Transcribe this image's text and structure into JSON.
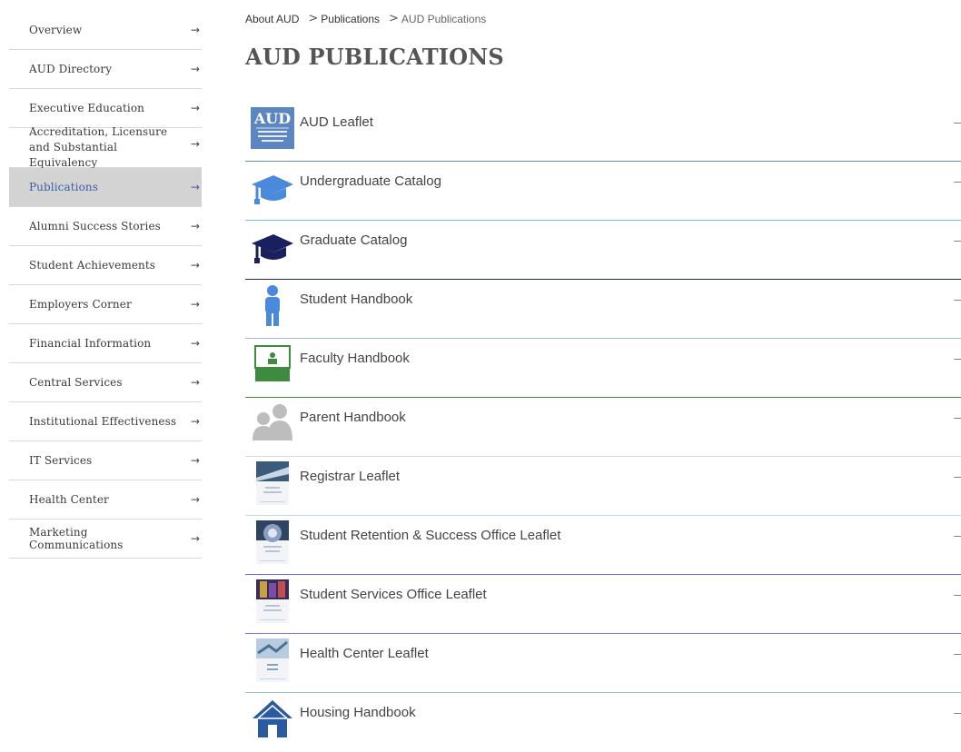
{
  "sidebar": {
    "items": [
      {
        "label": "Overview"
      },
      {
        "label": "AUD Directory"
      },
      {
        "label": "Executive Education"
      },
      {
        "label": "Accreditation, Licensure and Substantial Equivalency"
      },
      {
        "label": "Publications"
      },
      {
        "label": "Alumni Success Stories"
      },
      {
        "label": "Student Achievements"
      },
      {
        "label": "Employers Corner"
      },
      {
        "label": "Financial Information"
      },
      {
        "label": "Central Services"
      },
      {
        "label": "Institutional Effectiveness"
      },
      {
        "label": "IT Services"
      },
      {
        "label": "Health Center"
      },
      {
        "label": "Marketing Communications"
      }
    ],
    "arrow_glyph": "→",
    "active_item": "Publications"
  },
  "breadcrumb": {
    "items": [
      "About AUD",
      "Publications",
      "AUD Publications"
    ],
    "separator": ">"
  },
  "page_title": "AUD PUBLICATIONS",
  "logo_text": "AUD",
  "publications": [
    {
      "label": "AUD Leaflet",
      "icon": "aud-logo-icon",
      "divider_color": "#6b8fb6"
    },
    {
      "label": "Undergraduate Catalog",
      "icon": "graduation-cap-light-icon",
      "divider_color": "#7ec3e6"
    },
    {
      "label": "Graduate Catalog",
      "icon": "graduation-cap-dark-icon",
      "divider_color": "#1f2a5a"
    },
    {
      "label": "Student Handbook",
      "icon": "student-person-icon",
      "divider_color": "#9fb8ea"
    },
    {
      "label": "Faculty Handbook",
      "icon": "faculty-board-icon",
      "divider_color": "#3e8a3e"
    },
    {
      "label": "Parent Handbook",
      "icon": "parents-icon",
      "divider_color": "#d9d9d9"
    },
    {
      "label": "Registrar Leaflet",
      "icon": "registrar-leaflet-thumbnail-icon",
      "divider_color": "#c7d4ee"
    },
    {
      "label": "Student Retention & Success Office Leaflet",
      "icon": "retention-leaflet-thumbnail-icon",
      "divider_color": "#6070d0"
    },
    {
      "label": "Student Services Office Leaflet",
      "icon": "services-leaflet-thumbnail-icon",
      "divider_color": "#7a7ad8"
    },
    {
      "label": "Health Center Leaflet",
      "icon": "health-leaflet-thumbnail-icon",
      "divider_color": "#9fb8ea"
    },
    {
      "label": "Housing Handbook",
      "icon": "house-icon",
      "divider_color": "#ffffff"
    }
  ],
  "collapse_glyph": "–",
  "colors": {
    "active_bg": "#d3d3d3",
    "active_text": "#3f5fa8",
    "icon_blue": "#4a89dc",
    "icon_navy": "#1a1f5e",
    "icon_green": "#3e8a3e",
    "icon_gray": "#bdbdbd",
    "house_blue": "#2c5aa0"
  }
}
